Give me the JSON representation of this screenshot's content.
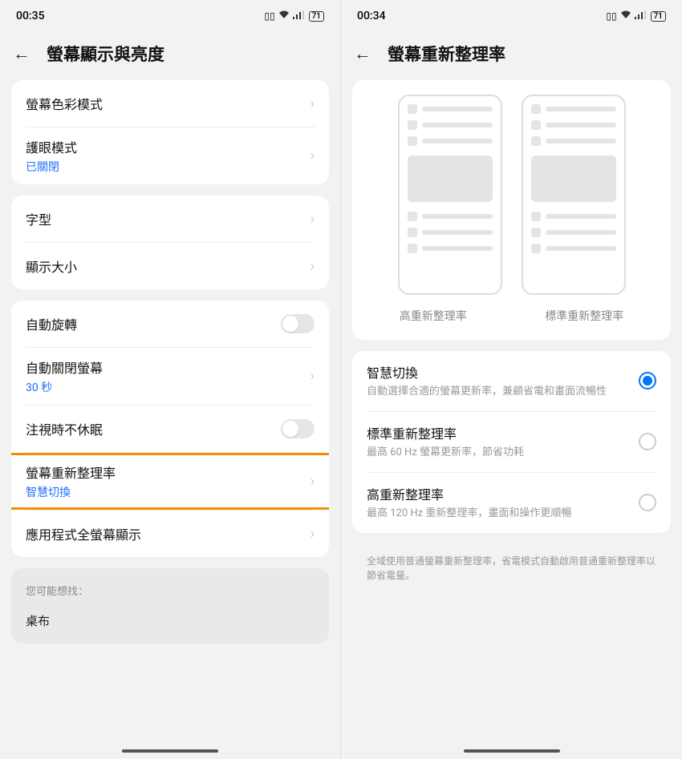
{
  "left": {
    "status": {
      "time": "00:35",
      "battery": "71"
    },
    "title": "螢幕顯示與亮度",
    "group1": {
      "color_mode": "螢幕色彩模式",
      "eye_comfort": {
        "label": "護眼模式",
        "status": "已關閉"
      }
    },
    "group2": {
      "font": "字型",
      "display_size": "顯示大小"
    },
    "group3": {
      "auto_rotate": "自動旋轉",
      "auto_off": {
        "label": "自動關閉螢幕",
        "value": "30 秒"
      },
      "stay_awake": "注視時不休眠",
      "refresh": {
        "label": "螢幕重新整理率",
        "value": "智慧切換"
      },
      "fullscreen": "應用程式全螢幕顯示"
    },
    "suggest": {
      "label": "您可能想找：",
      "item": "桌布"
    }
  },
  "right": {
    "status": {
      "time": "00:34",
      "battery": "71"
    },
    "title": "螢幕重新整理率",
    "illus": {
      "high": "高重新整理率",
      "standard": "標準重新整理率"
    },
    "options": {
      "smart": {
        "title": "智慧切換",
        "desc": "自動選擇合適的螢幕更新率，兼顧省電和畫面流暢性"
      },
      "standard": {
        "title": "標準重新整理率",
        "desc": "最高 60 Hz 螢幕更新率，節省功耗"
      },
      "high": {
        "title": "高重新整理率",
        "desc": "最高 120 Hz 重新整理率，畫面和操作更順暢"
      }
    },
    "footnote": "全域使用普通螢幕重新整理率，省電模式自動啟用普通重新整理率以節省電量。"
  }
}
